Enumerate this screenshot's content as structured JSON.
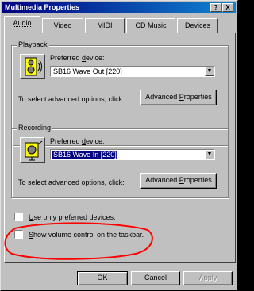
{
  "window": {
    "title": "Multimedia Properties",
    "help_button": "?",
    "close_button": "X"
  },
  "tabs": [
    {
      "label": "Audio",
      "active": true
    },
    {
      "label": "Video",
      "active": false
    },
    {
      "label": "MIDI",
      "active": false
    },
    {
      "label": "CD Music",
      "active": false
    },
    {
      "label": "Devices",
      "active": false
    }
  ],
  "playback": {
    "group_label": "Playback",
    "device_label_pre": "Preferred ",
    "device_label_ul": "d",
    "device_label_post": "evice:",
    "device_value": "SB16 Wave Out [220]",
    "advanced_hint": "To select advanced options, click:",
    "advanced_button_pre": "Advanced ",
    "advanced_button_ul": "P",
    "advanced_button_post": "roperties",
    "icon": "speaker-icon"
  },
  "recording": {
    "group_label": "Recording",
    "device_label_pre": "Preferred ",
    "device_label_ul": "d",
    "device_label_post": "evice:",
    "device_value": "SB16 Wave In [220]",
    "advanced_hint": "To select advanced options, click:",
    "advanced_button_pre": "Advanced ",
    "advanced_button_ul": "P",
    "advanced_button_post": "roperties",
    "icon": "microphone-icon"
  },
  "options": {
    "use_preferred_ul": "U",
    "use_preferred_rest": "se only preferred devices.",
    "use_preferred_checked": false,
    "show_volume_ul": "S",
    "show_volume_rest": "how volume control on the taskbar.",
    "show_volume_checked": false
  },
  "footer": {
    "ok_label": "OK",
    "cancel_label": "Cancel",
    "apply_label": "Apply"
  },
  "colors": {
    "title_bar": "#000080",
    "annotation": "#ff0000",
    "dialog_face": "#c0c0c0"
  }
}
